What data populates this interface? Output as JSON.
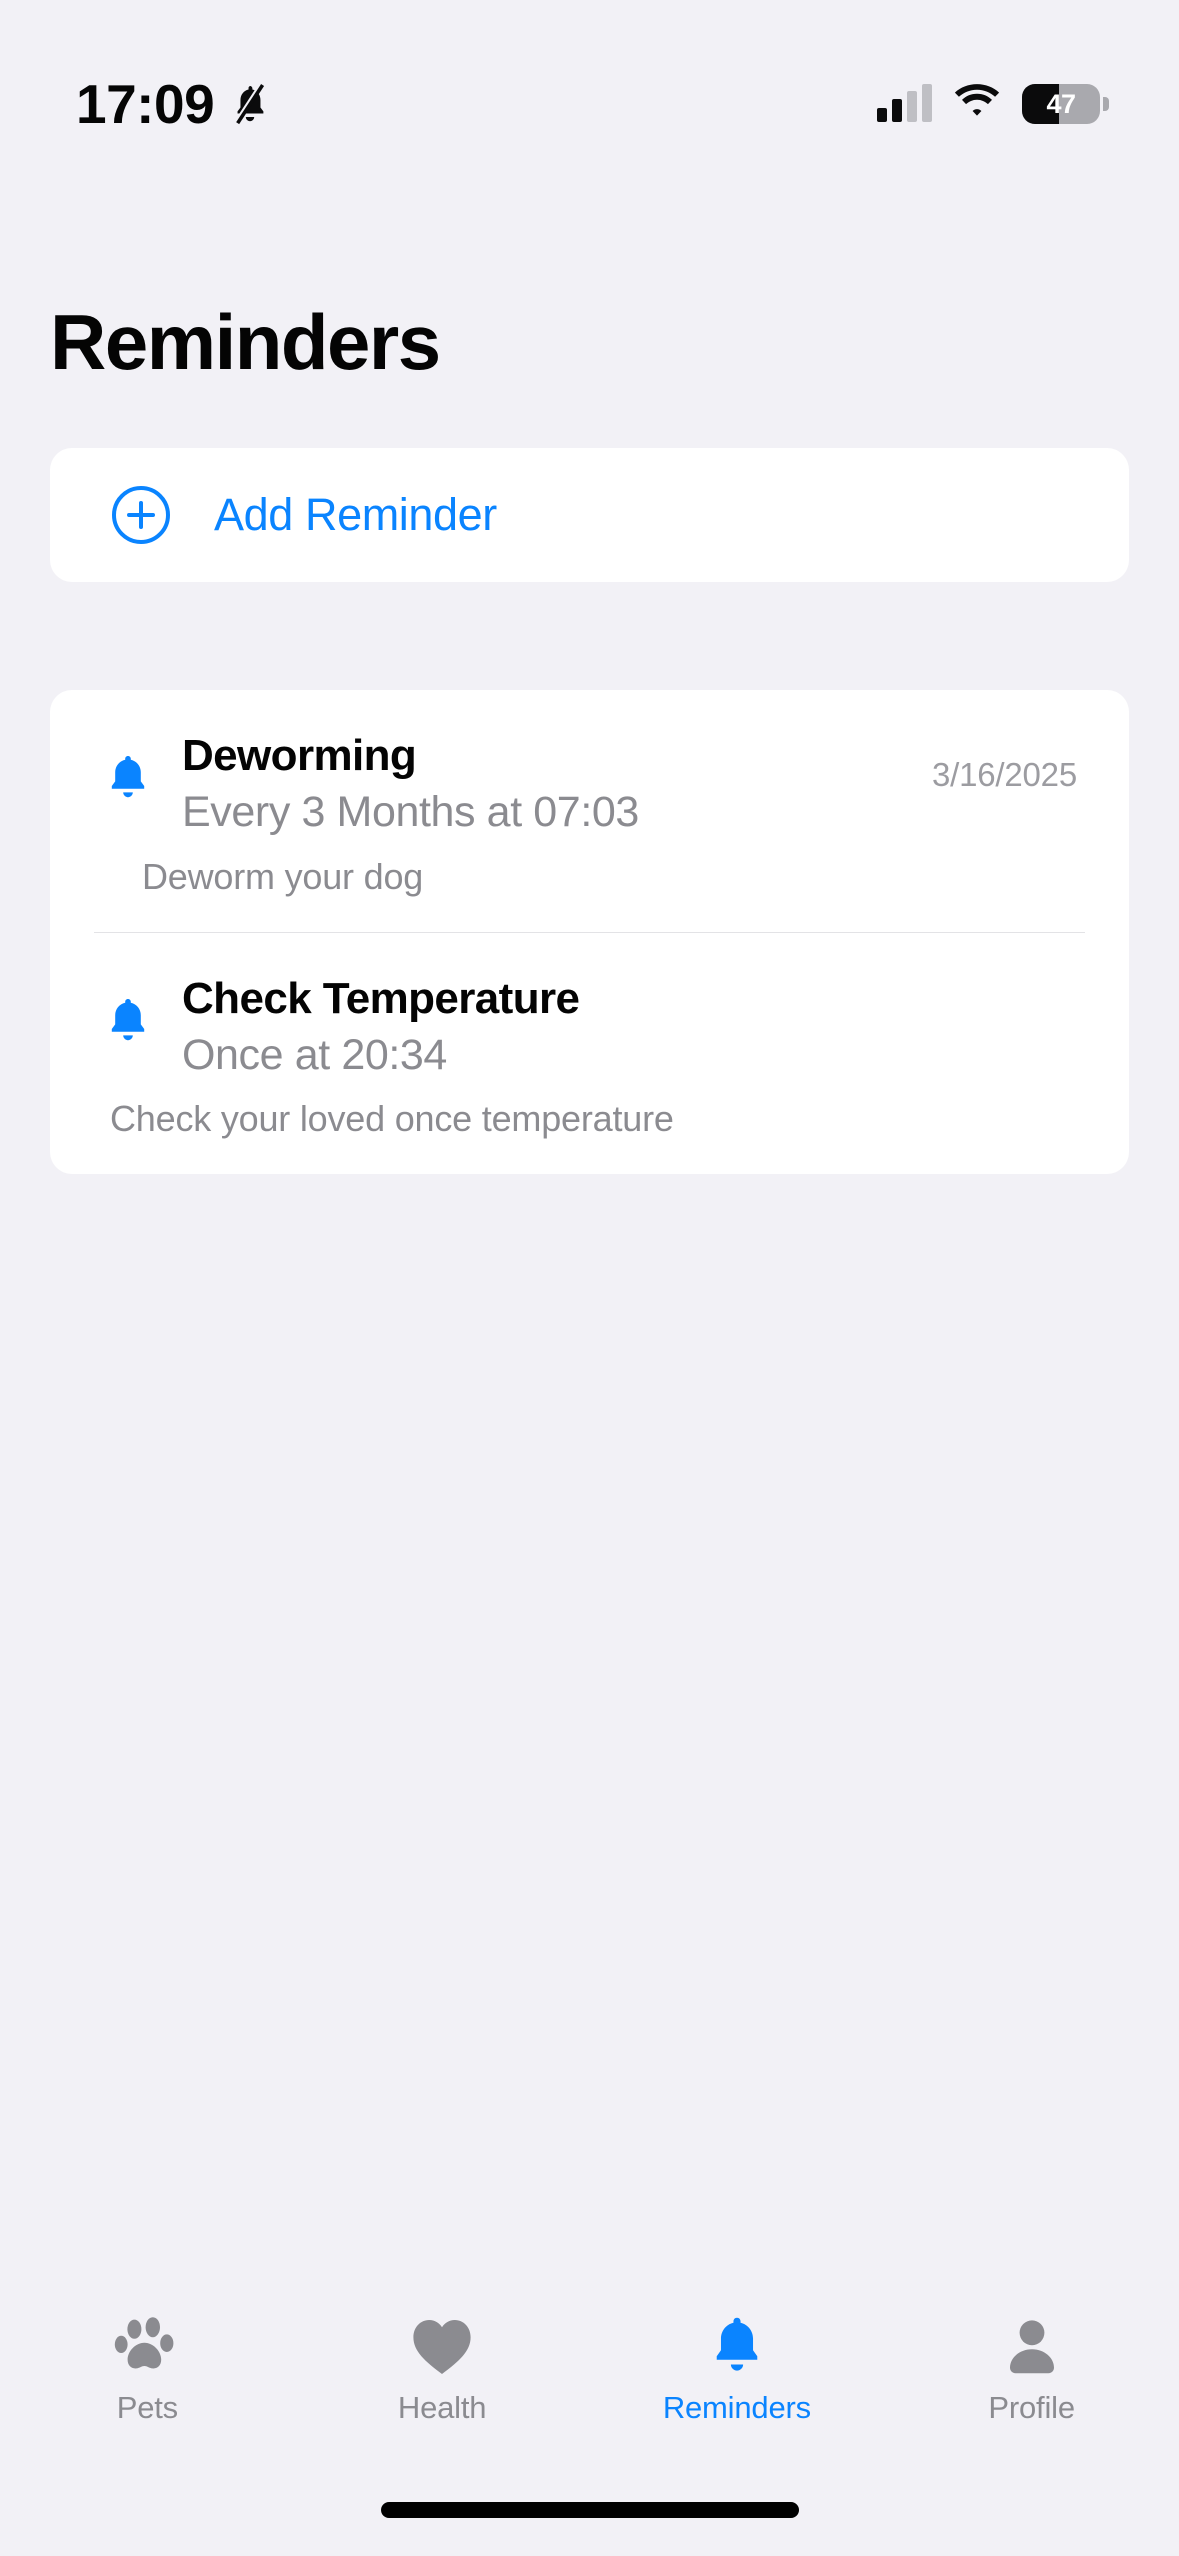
{
  "status_bar": {
    "time": "17:09",
    "mute_icon": "bell-slash-icon",
    "cellular_icon": "cellular-bars-icon",
    "wifi_icon": "wifi-icon",
    "battery_percent": "47",
    "battery_level": 47
  },
  "header": {
    "title": "Reminders"
  },
  "add_reminder": {
    "icon": "plus-circle-icon",
    "label": "Add Reminder",
    "accent_color": "#0A84FF"
  },
  "reminders": [
    {
      "icon": "bell-icon",
      "title": "Deworming",
      "schedule": "Every 3 Months at 07:03",
      "date": "3/16/2025",
      "note": "Deworm your dog"
    },
    {
      "icon": "bell-icon",
      "title": "Check Temperature",
      "schedule": "Once at 20:34",
      "date": "",
      "note": "Check your loved once temperature"
    }
  ],
  "tab_bar": {
    "items": [
      {
        "icon": "paw-icon",
        "label": "Pets",
        "active": false
      },
      {
        "icon": "heart-icon",
        "label": "Health",
        "active": false
      },
      {
        "icon": "bell-icon",
        "label": "Reminders",
        "active": true
      },
      {
        "icon": "person-icon",
        "label": "Profile",
        "active": false
      }
    ],
    "active_color": "#0A84FF",
    "inactive_color": "#8B8B90"
  },
  "colors": {
    "background": "#F2F1F6",
    "card": "#FFFFFF",
    "accent": "#0A84FF",
    "primary_text": "#040404",
    "secondary_text": "#8B8B90"
  }
}
